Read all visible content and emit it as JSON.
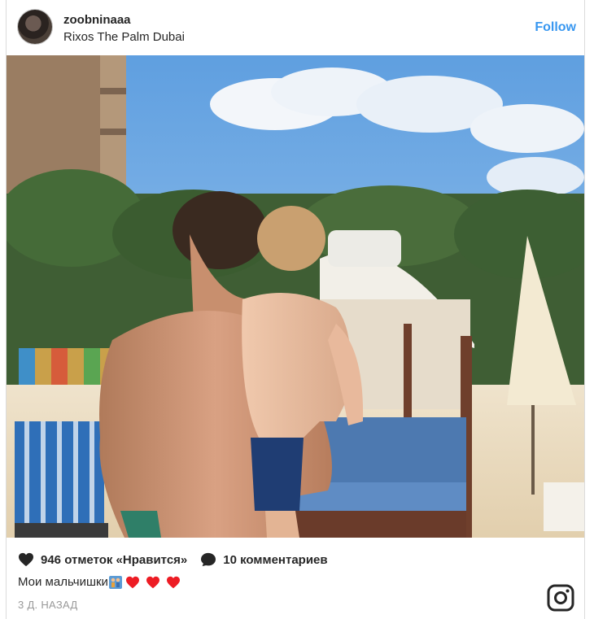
{
  "post": {
    "username": "zoobninaaa",
    "location": "Rixos The Palm Dubai",
    "follow_label": "Follow",
    "likes_text": "946 отметок «Нравится»",
    "comments_text": "10 комментариев",
    "caption_text": "Мои мальчишки",
    "caption_emojis": [
      "family-icon",
      "heart-icon",
      "heart-icon",
      "heart-icon"
    ],
    "time_text": "3 Д. НАЗАД"
  },
  "colors": {
    "accent": "#3897f0",
    "heart": "#ed1c24",
    "muted": "#999999"
  },
  "icons": {
    "like": "heart-icon",
    "comment": "speech-bubble-icon",
    "brand": "instagram-logo-icon"
  }
}
